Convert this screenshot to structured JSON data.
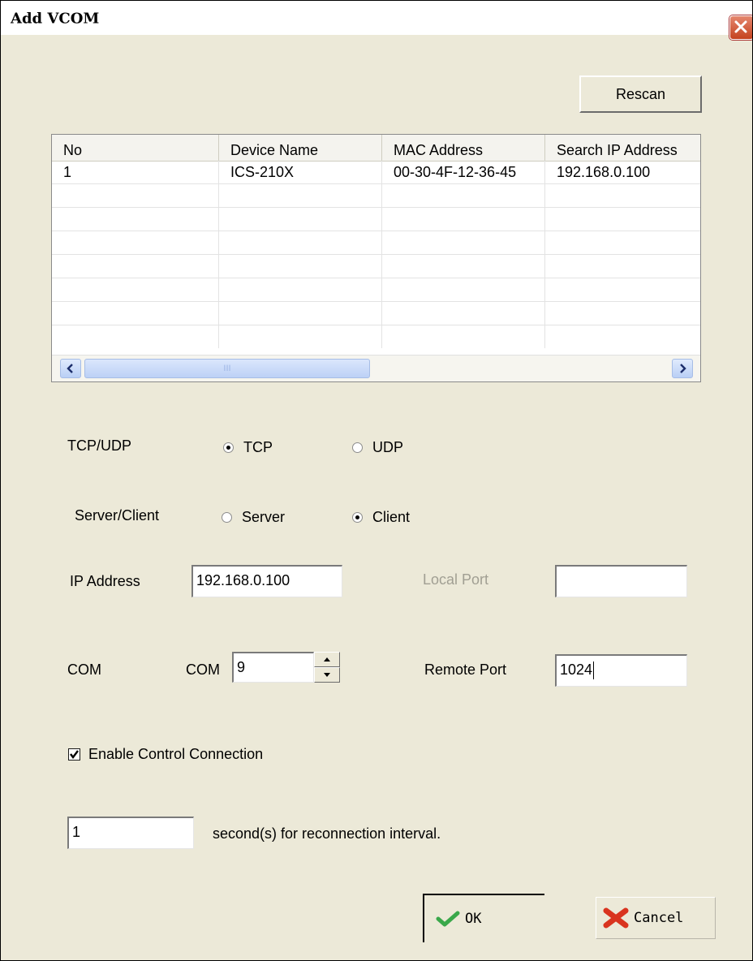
{
  "window": {
    "title": "Add VCOM"
  },
  "buttons": {
    "rescan": "Rescan",
    "ok": "OK",
    "cancel": "Cancel"
  },
  "device_list": {
    "columns": [
      "No",
      "Device Name",
      "MAC Address",
      "Search IP Address"
    ],
    "rows": [
      [
        "1",
        "ICS-210X",
        "00-30-4F-12-36-45",
        "192.168.0.100"
      ]
    ],
    "scroll_thumb_grip": "III"
  },
  "protocol": {
    "label": "TCP/UDP",
    "options": [
      "TCP",
      "UDP"
    ],
    "selected": "TCP"
  },
  "mode": {
    "label": "Server/Client",
    "options": [
      "Server",
      "Client"
    ],
    "selected": "Client"
  },
  "ip": {
    "label": "IP Address",
    "value": "192.168.0.100"
  },
  "local_port": {
    "label": "Local Port",
    "value": ""
  },
  "com": {
    "label": "COM",
    "prefix": "COM",
    "value": "9"
  },
  "remote_port": {
    "label": "Remote Port",
    "value": "1024"
  },
  "control_connection": {
    "label": "Enable Control Connection",
    "checked": true
  },
  "reconnect": {
    "value": "1",
    "suffix": "second(s) for reconnection interval."
  },
  "colors": {
    "dialog_bg": "#ece9d8",
    "ok_icon": "#3aa84a",
    "cancel_icon": "#d9341f",
    "scroll": "#bcd1f6"
  }
}
